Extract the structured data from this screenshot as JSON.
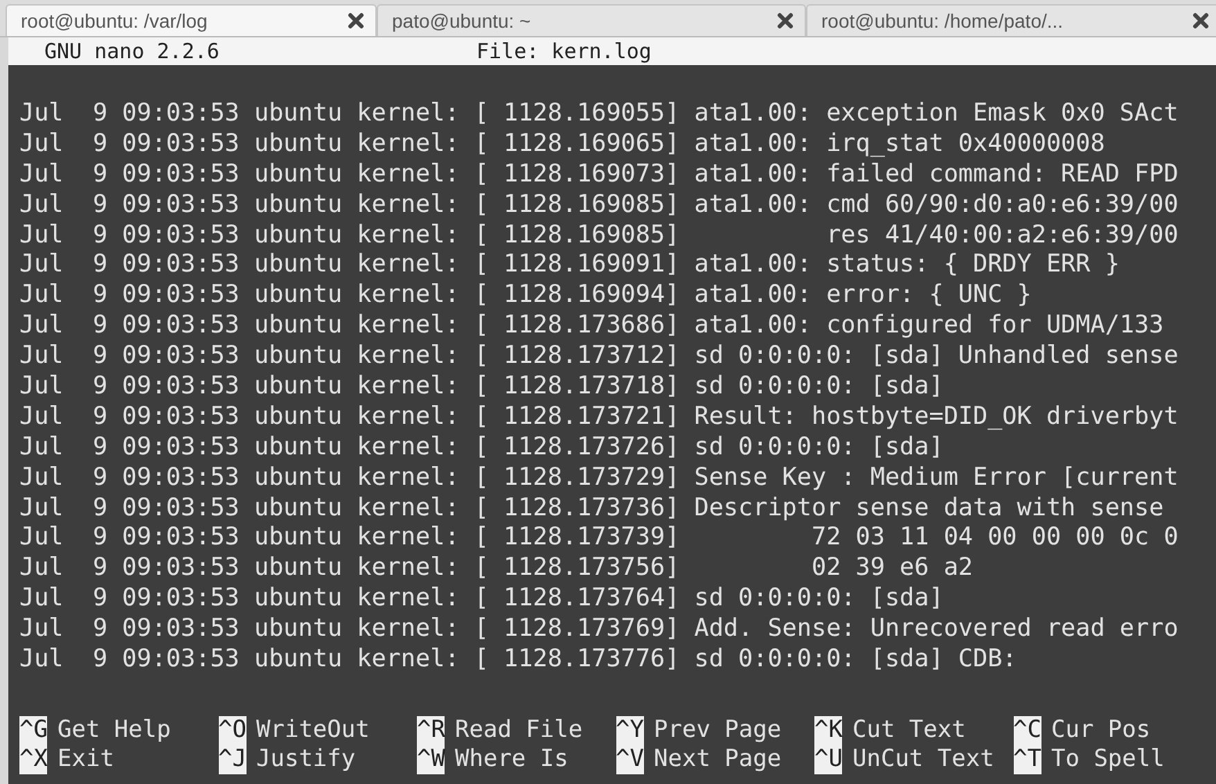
{
  "tabs": [
    {
      "label": "root@ubuntu: /var/log",
      "selected": true
    },
    {
      "label": "pato@ubuntu: ~",
      "selected": false
    },
    {
      "label": "root@ubuntu: /home/pato/...",
      "selected": false
    }
  ],
  "nano_header": {
    "version": "GNU nano 2.2.6",
    "file": "File: kern.log"
  },
  "lines": [
    "Jul  9 09:03:53 ubuntu kernel: [ 1128.169055] ata1.00: exception Emask 0x0 SAct",
    "Jul  9 09:03:53 ubuntu kernel: [ 1128.169065] ata1.00: irq_stat 0x40000008",
    "Jul  9 09:03:53 ubuntu kernel: [ 1128.169073] ata1.00: failed command: READ FPD",
    "Jul  9 09:03:53 ubuntu kernel: [ 1128.169085] ata1.00: cmd 60/90:d0:a0:e6:39/00",
    "Jul  9 09:03:53 ubuntu kernel: [ 1128.169085]          res 41/40:00:a2:e6:39/00",
    "Jul  9 09:03:53 ubuntu kernel: [ 1128.169091] ata1.00: status: { DRDY ERR }",
    "Jul  9 09:03:53 ubuntu kernel: [ 1128.169094] ata1.00: error: { UNC }",
    "Jul  9 09:03:53 ubuntu kernel: [ 1128.173686] ata1.00: configured for UDMA/133",
    "Jul  9 09:03:53 ubuntu kernel: [ 1128.173712] sd 0:0:0:0: [sda] Unhandled sense",
    "Jul  9 09:03:53 ubuntu kernel: [ 1128.173718] sd 0:0:0:0: [sda]",
    "Jul  9 09:03:53 ubuntu kernel: [ 1128.173721] Result: hostbyte=DID_OK driverbyt",
    "Jul  9 09:03:53 ubuntu kernel: [ 1128.173726] sd 0:0:0:0: [sda]",
    "Jul  9 09:03:53 ubuntu kernel: [ 1128.173729] Sense Key : Medium Error [current",
    "Jul  9 09:03:53 ubuntu kernel: [ 1128.173736] Descriptor sense data with sense",
    "Jul  9 09:03:53 ubuntu kernel: [ 1128.173739]         72 03 11 04 00 00 00 0c 0",
    "Jul  9 09:03:53 ubuntu kernel: [ 1128.173756]         02 39 e6 a2",
    "Jul  9 09:03:53 ubuntu kernel: [ 1128.173764] sd 0:0:0:0: [sda]",
    "Jul  9 09:03:53 ubuntu kernel: [ 1128.173769] Add. Sense: Unrecovered read erro",
    "Jul  9 09:03:53 ubuntu kernel: [ 1128.173776] sd 0:0:0:0: [sda] CDB:"
  ],
  "shortcuts": [
    [
      {
        "key": "^G",
        "label": "Get Help"
      },
      {
        "key": "^O",
        "label": "WriteOut"
      },
      {
        "key": "^R",
        "label": "Read File"
      },
      {
        "key": "^Y",
        "label": "Prev Page"
      },
      {
        "key": "^K",
        "label": "Cut Text"
      },
      {
        "key": "^C",
        "label": "Cur Pos"
      }
    ],
    [
      {
        "key": "^X",
        "label": "Exit"
      },
      {
        "key": "^J",
        "label": "Justify"
      },
      {
        "key": "^W",
        "label": "Where Is"
      },
      {
        "key": "^V",
        "label": "Next Page"
      },
      {
        "key": "^U",
        "label": "UnCut Text"
      },
      {
        "key": "^T",
        "label": "To Spell"
      }
    ]
  ]
}
